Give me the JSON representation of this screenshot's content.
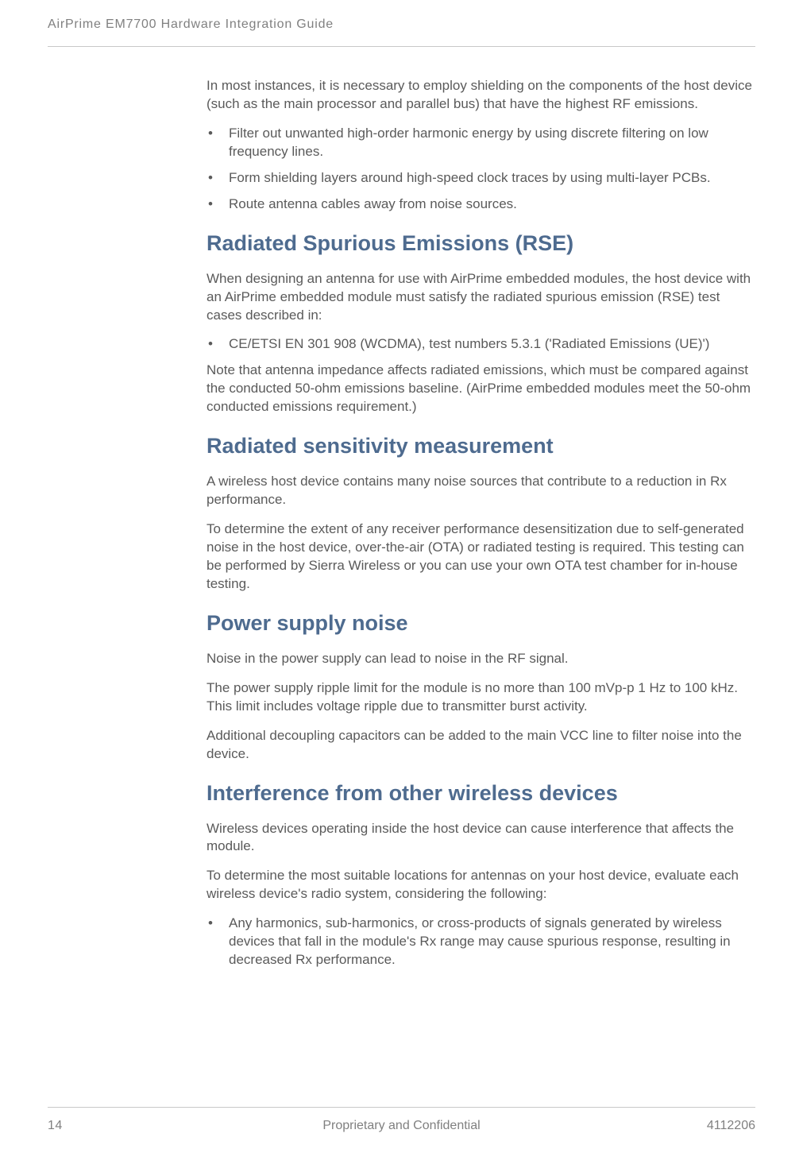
{
  "header": "AirPrime EM7700 Hardware Integration Guide",
  "body": {
    "intro_p": "In most instances, it is necessary to employ shielding on the components of the host device (such as the main processor and parallel bus) that have the highest RF emissions.",
    "intro_bullets": [
      "Filter out unwanted high-order harmonic energy by using discrete filtering on low frequency lines.",
      "Form shielding layers around high-speed clock traces by using multi-layer PCBs.",
      "Route antenna cables away from noise sources."
    ],
    "rse_heading": "Radiated Spurious Emissions (RSE)",
    "rse_p1": "When designing an antenna for use with AirPrime embedded modules, the host device with an AirPrime embedded module must satisfy the radiated spurious emission (RSE) test cases described in:",
    "rse_bullets": [
      "CE/ETSI EN 301 908 (WCDMA), test numbers 5.3.1 ('Radiated Emissions (UE)')"
    ],
    "rse_p2": "Note that antenna impedance affects radiated emissions, which must be compared against the conducted 50-ohm emissions baseline. (AirPrime embedded modules meet the 50-ohm conducted emissions requirement.)",
    "rsm_heading": "Radiated sensitivity measurement",
    "rsm_p1": "A wireless host device contains many noise sources that contribute to a reduction in Rx performance.",
    "rsm_p2": "To determine the extent of any receiver performance desensitization due to self-generated noise in the host device, over-the-air (OTA) or radiated testing is required. This testing can be performed by Sierra Wireless or you can use your own OTA test chamber for in-house testing.",
    "psn_heading": "Power supply noise",
    "psn_p1": "Noise in the power supply can lead to noise in the RF signal.",
    "psn_p2": "The power supply ripple limit for the module is no more than 100 mVp-p 1 Hz to 100 kHz. This limit includes voltage ripple due to transmitter burst activity.",
    "psn_p3": "Additional decoupling capacitors can be added to the main VCC line to filter noise into the device.",
    "ifo_heading": "Interference from other wireless devices",
    "ifo_p1": "Wireless devices operating inside the host device can cause interference that affects the module.",
    "ifo_p2": "To determine the most suitable locations for antennas on your host device, evaluate each wireless device's radio system, considering the following:",
    "ifo_bullets": [
      "Any harmonics, sub-harmonics, or cross-products of signals generated by wireless devices that fall in the module's Rx range may cause spurious response, resulting in decreased Rx performance."
    ]
  },
  "footer": {
    "left": "14",
    "center": "Proprietary and Confidential",
    "right": "4112206"
  }
}
